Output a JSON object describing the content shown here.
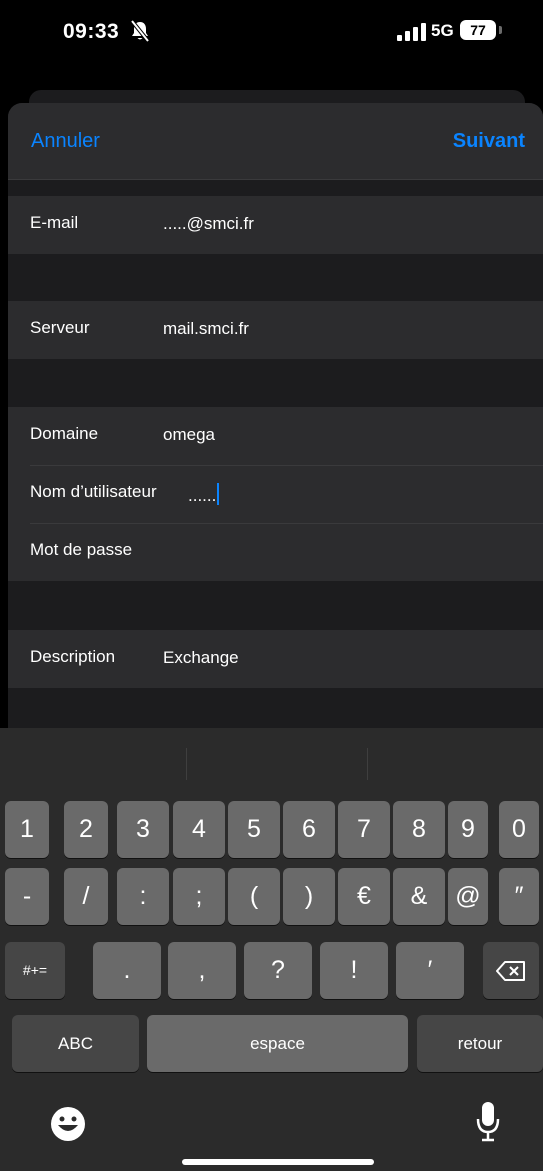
{
  "status_bar": {
    "time": "09:33",
    "network": "5G",
    "battery": "77"
  },
  "nav": {
    "cancel_label": "Annuler",
    "next_label": "Suivant"
  },
  "form": {
    "email": {
      "label": "E-mail",
      "value": ".....@smci.fr"
    },
    "server": {
      "label": "Serveur",
      "value": "mail.smci.fr"
    },
    "domain": {
      "label": "Domaine",
      "value": "omega"
    },
    "username": {
      "label": "Nom d’utilisateur",
      "value": "......"
    },
    "password": {
      "label": "Mot de passe",
      "value": ""
    },
    "description": {
      "label": "Description",
      "value": "Exchange"
    }
  },
  "keyboard": {
    "row1": [
      "1",
      "2",
      "3",
      "4",
      "5",
      "6",
      "7",
      "8",
      "9",
      "0"
    ],
    "row2": [
      "-",
      "/",
      ":",
      ";",
      "(",
      ")",
      "€",
      "&",
      "@",
      "″"
    ],
    "row3_mode": "#+=",
    "row3": [
      ".",
      ",",
      "?",
      "!",
      "′"
    ],
    "abc_label": "ABC",
    "space_label": "espace",
    "return_label": "retour",
    "icons": [
      "emoji-icon",
      "microphone-icon",
      "backspace-icon"
    ]
  },
  "colors": {
    "accent": "#0a84ff",
    "sheet_background": "#1c1c1e",
    "cell_background": "#2c2c2e",
    "key_light": "#6a6a6a",
    "key_dark": "#464646"
  }
}
